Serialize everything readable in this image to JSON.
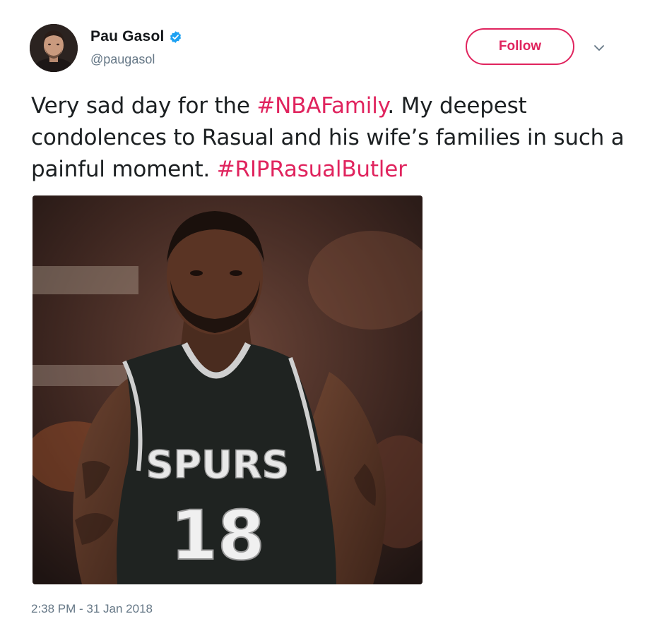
{
  "author": {
    "display_name": "Pau Gasol",
    "handle": "@paugasol",
    "verified": true,
    "avatar_icon": "user-avatar"
  },
  "actions": {
    "follow_label": "Follow",
    "caret_icon": "chevron-down-icon"
  },
  "tweet": {
    "text_parts": [
      {
        "type": "text",
        "value": "Very sad day for the "
      },
      {
        "type": "hashtag",
        "value": "#NBAFamily"
      },
      {
        "type": "text",
        "value": ". My deepest condolences to Rasual and his wife’s families in such a painful moment. "
      },
      {
        "type": "hashtag",
        "value": "#RIPRasualButler"
      }
    ],
    "hashtag_1": "#NBAFamily",
    "text_1": "Very sad day for the ",
    "text_2": ". My deepest condolences to Rasual and his wife’s families in such a painful moment. ",
    "hashtag_2": "#RIPRasualButler",
    "media": {
      "jersey_team": "SPURS",
      "jersey_number": "18"
    },
    "timestamp": "2:38 PM - 31 Jan 2018"
  },
  "colors": {
    "accent": "#e0245e",
    "verified": "#1da1f2",
    "secondary_text": "#657786",
    "primary_text": "#14171a"
  }
}
